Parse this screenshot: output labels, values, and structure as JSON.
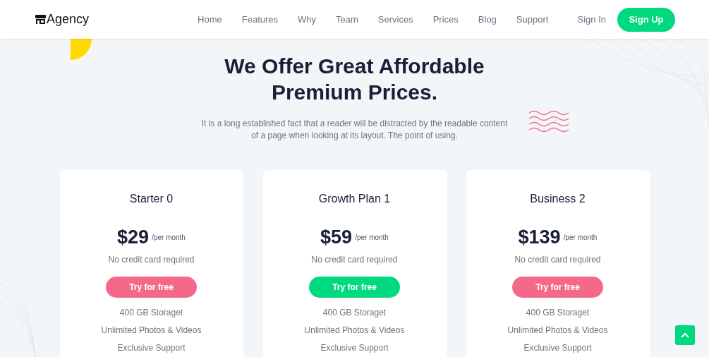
{
  "brand": {
    "name": "Agency"
  },
  "nav": [
    {
      "label": "Home"
    },
    {
      "label": "Features"
    },
    {
      "label": "Why"
    },
    {
      "label": "Team"
    },
    {
      "label": "Services"
    },
    {
      "label": "Prices"
    },
    {
      "label": "Blog"
    },
    {
      "label": "Support"
    }
  ],
  "auth": {
    "sign_in": "Sign In",
    "sign_up": "Sign Up"
  },
  "hero": {
    "title_lines": [
      "We Offer Great Affordable",
      "Premium Prices."
    ],
    "text_lines": [
      "It is a long established fact that a reader will be distracted by the readable content",
      "of a page when looking at its layout. The point of using."
    ]
  },
  "plans": [
    {
      "name": "Starter 0",
      "price": "$29",
      "period": "/per month",
      "note": "No credit card required",
      "button": "Try for free",
      "highlighted": false,
      "features": [
        "400 GB Storaget",
        "Unlimited Photos & Videos",
        "Exclusive Support"
      ]
    },
    {
      "name": "Growth Plan 1",
      "price": "$59",
      "period": "/per month",
      "note": "No credit card required",
      "button": "Try for free",
      "highlighted": true,
      "features": [
        "400 GB Storaget",
        "Unlimited Photos & Videos",
        "Exclusive Support"
      ]
    },
    {
      "name": "Business 2",
      "price": "$139",
      "period": "/per month",
      "note": "No credit card required",
      "button": "Try for free",
      "highlighted": false,
      "features": [
        "400 GB Storaget",
        "Unlimited Photos & Videos",
        "Exclusive Support"
      ]
    }
  ]
}
